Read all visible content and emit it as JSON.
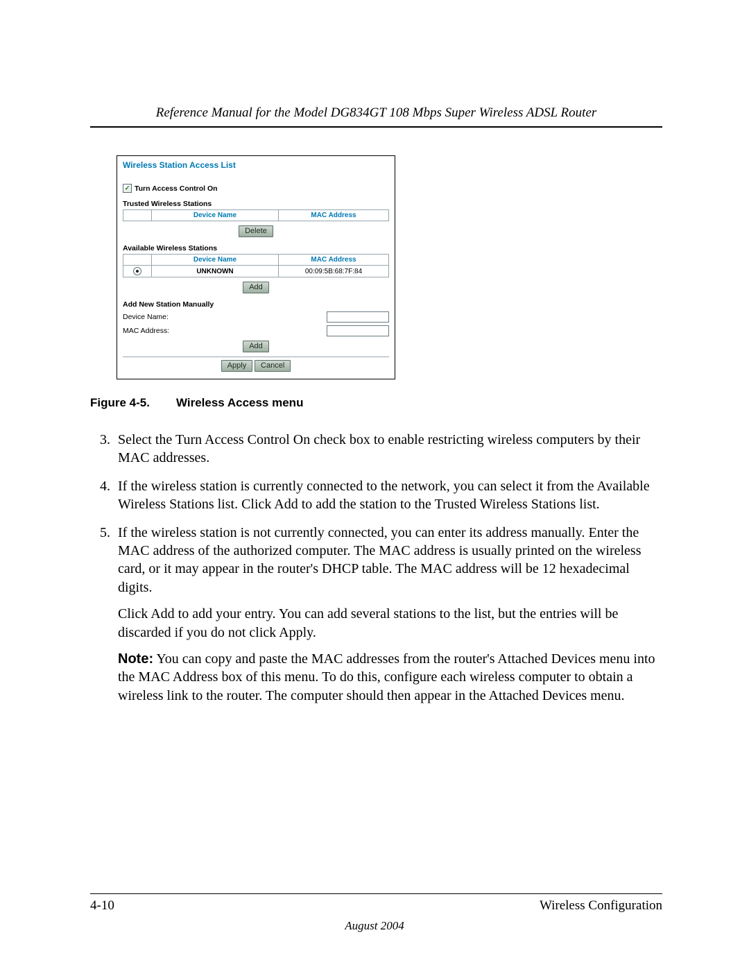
{
  "doc": {
    "header_title": "Reference Manual for the Model DG834GT 108 Mbps Super Wireless ADSL Router",
    "page_number": "4-10",
    "section_name": "Wireless Configuration",
    "date": "August 2004"
  },
  "panel": {
    "title": "Wireless Station Access List",
    "access_control_label": "Turn Access Control On",
    "trusted_label": "Trusted Wireless Stations",
    "available_label": "Available Wireless Stations",
    "manual_label": "Add New Station Manually",
    "headers": {
      "device": "Device Name",
      "mac": "MAC Address"
    },
    "available_rows": [
      {
        "device": "UNKNOWN",
        "mac": "00:09:5B:68:7F:84"
      }
    ],
    "manual_fields": {
      "device_label": "Device Name:",
      "mac_label": "MAC Address:"
    },
    "buttons": {
      "delete": "Delete",
      "add": "Add",
      "apply": "Apply",
      "cancel": "Cancel"
    }
  },
  "figcap": {
    "prefix": "Figure 4-5.",
    "title": "Wireless Access menu"
  },
  "steps": {
    "three": "Select the Turn Access Control On check box to enable restricting wireless computers by their MAC addresses.",
    "four": "If the wireless station is currently connected to the network, you can select it from the Available Wireless Stations list. Click Add to add the station to the Trusted Wireless Stations list.",
    "five": "If the wireless station is not currently connected, you can enter its address manually. Enter the MAC address of the authorized computer. The MAC address is usually printed on the wireless card, or it may appear in the router's DHCP table. The MAC address will be 12 hexadecimal digits.",
    "five_p2": "Click Add to add your entry. You can add several stations to the list, but the entries will be discarded if you do not click Apply.",
    "note_label": "Note:",
    "note_body": " You can copy and paste the MAC addresses from the router's Attached Devices menu into the MAC Address box of this menu. To do this, configure each wireless computer to obtain a wireless link to the router. The computer should then appear in the Attached Devices menu."
  }
}
